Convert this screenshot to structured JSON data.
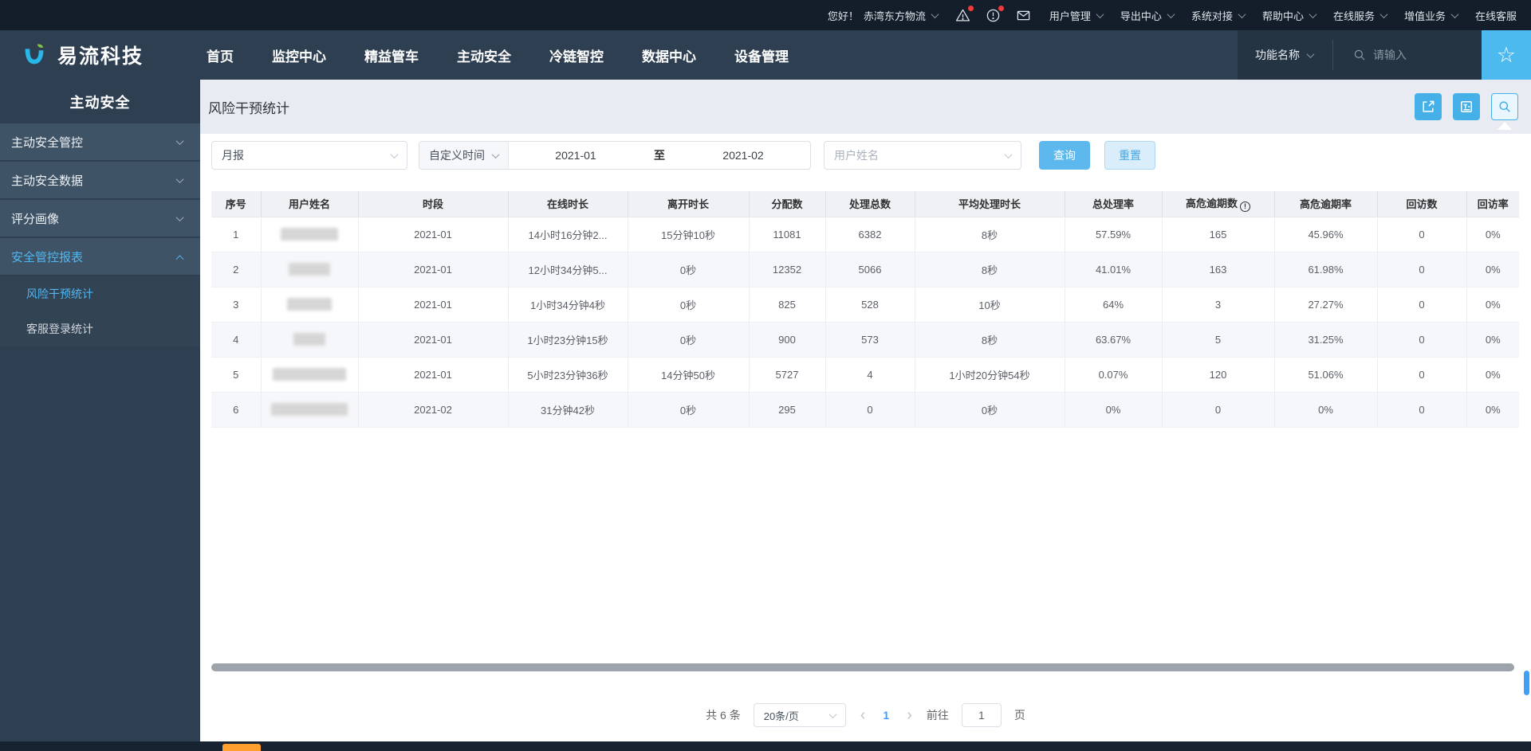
{
  "topbar": {
    "greeting": "您好！",
    "company": "赤湾东方物流",
    "menus": [
      "用户管理",
      "导出中心",
      "系统对接",
      "帮助中心",
      "在线服务",
      "增值业务"
    ],
    "last_item": "在线客服",
    "icons": [
      "warning-triangle",
      "alert-circle",
      "mail"
    ]
  },
  "navbar": {
    "brand": "易流科技",
    "items": [
      "首页",
      "监控中心",
      "精益管车",
      "主动安全",
      "冷链智控",
      "数据中心",
      "设备管理"
    ],
    "func_label": "功能名称",
    "search_placeholder": "请输入"
  },
  "sidebar": {
    "title": "主动安全",
    "groups": [
      {
        "label": "主动安全管控",
        "expanded": false,
        "active": false
      },
      {
        "label": "主动安全数据",
        "expanded": false,
        "active": false
      },
      {
        "label": "评分画像",
        "expanded": false,
        "active": false
      },
      {
        "label": "安全管控报表",
        "expanded": true,
        "active": true
      }
    ],
    "subitems": [
      {
        "label": "风险干预统计",
        "active": true
      },
      {
        "label": "客服登录统计",
        "active": false
      }
    ]
  },
  "page": {
    "title": "风险干预统计"
  },
  "filters": {
    "report_type": "月报",
    "time_mode": "自定义时间",
    "date_from": "2021-01",
    "to_label": "至",
    "date_to": "2021-02",
    "user_placeholder": "用户姓名",
    "query_label": "查询",
    "reset_label": "重置"
  },
  "table": {
    "headers": [
      "序号",
      "用户姓名",
      "时段",
      "在线时长",
      "离开时长",
      "分配数",
      "处理总数",
      "平均处理时长",
      "总处理率",
      "高危逾期数",
      "高危逾期率",
      "回访数",
      "回访率"
    ],
    "info_header_index": 9,
    "rows": [
      [
        "1",
        null,
        "2021-01",
        "14小时16分钟2...",
        "15分钟10秒",
        "11081",
        "6382",
        "8秒",
        "57.59%",
        "165",
        "45.96%",
        "0",
        "0%"
      ],
      [
        "2",
        null,
        "2021-01",
        "12小时34分钟5...",
        "0秒",
        "12352",
        "5066",
        "8秒",
        "41.01%",
        "163",
        "61.98%",
        "0",
        "0%"
      ],
      [
        "3",
        null,
        "2021-01",
        "1小时34分钟4秒",
        "0秒",
        "825",
        "528",
        "10秒",
        "64%",
        "3",
        "27.27%",
        "0",
        "0%"
      ],
      [
        "4",
        null,
        "2021-01",
        "1小时23分钟15秒",
        "0秒",
        "900",
        "573",
        "8秒",
        "63.67%",
        "5",
        "31.25%",
        "0",
        "0%"
      ],
      [
        "5",
        null,
        "2021-01",
        "5小时23分钟36秒",
        "14分钟50秒",
        "5727",
        "4",
        "1小时20分钟54秒",
        "0.07%",
        "120",
        "51.06%",
        "0",
        "0%"
      ],
      [
        "6",
        null,
        "2021-02",
        "31分钟42秒",
        "0秒",
        "295",
        "0",
        "0秒",
        "0%",
        "0",
        "0%",
        "0",
        "0%"
      ]
    ]
  },
  "pagination": {
    "total": "共 6 条",
    "page_size": "20条/页",
    "current_page": "1",
    "goto_label": "前往",
    "goto_value": "1",
    "page_unit": "页"
  },
  "colors": {
    "accent_blue": "#45b0e8",
    "active_text": "#53b6ef",
    "topbar_bg": "#141e2a",
    "nav_bg": "#2e3f51",
    "badge_red": "#f03b3b",
    "pager_active": "#409eff"
  }
}
